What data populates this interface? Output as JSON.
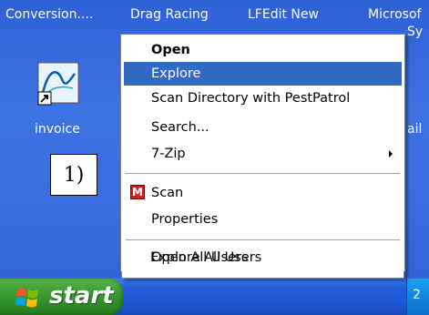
{
  "desktop": {
    "top_row_labels": [
      {
        "name": "desktop-item-conversion",
        "label": "Conversion...."
      },
      {
        "name": "desktop-item-drag-racing",
        "label": "Drag Racing"
      },
      {
        "name": "desktop-item-lfedit-new",
        "label": "LFEdit New"
      },
      {
        "name": "desktop-item-microsoft",
        "label": "Microsof"
      }
    ],
    "invoice_label": "invoice",
    "right_partial_label": "ail",
    "microsoft_second_line": "Sy"
  },
  "annotation": {
    "text": "1)"
  },
  "taskbar": {
    "start_label": "start",
    "tray_text": "2"
  },
  "context_menu": {
    "items": [
      {
        "label": "Open",
        "bold": true
      },
      {
        "label": "Explore",
        "highlighted": true
      },
      {
        "label": "Scan Directory with PestPatrol"
      },
      {
        "label": "Search..."
      },
      {
        "label": "7-Zip",
        "has_submenu": true
      },
      {
        "label": "Scan",
        "icon": "mcafee-icon"
      },
      {
        "label": "Properties"
      },
      {
        "label": "Open All Users"
      },
      {
        "label": "Explore All Users"
      }
    ]
  },
  "colors": {
    "desktop_blue": "#3a6ee0",
    "menu_highlight": "#316ac5",
    "start_green": "#3d9b33"
  }
}
